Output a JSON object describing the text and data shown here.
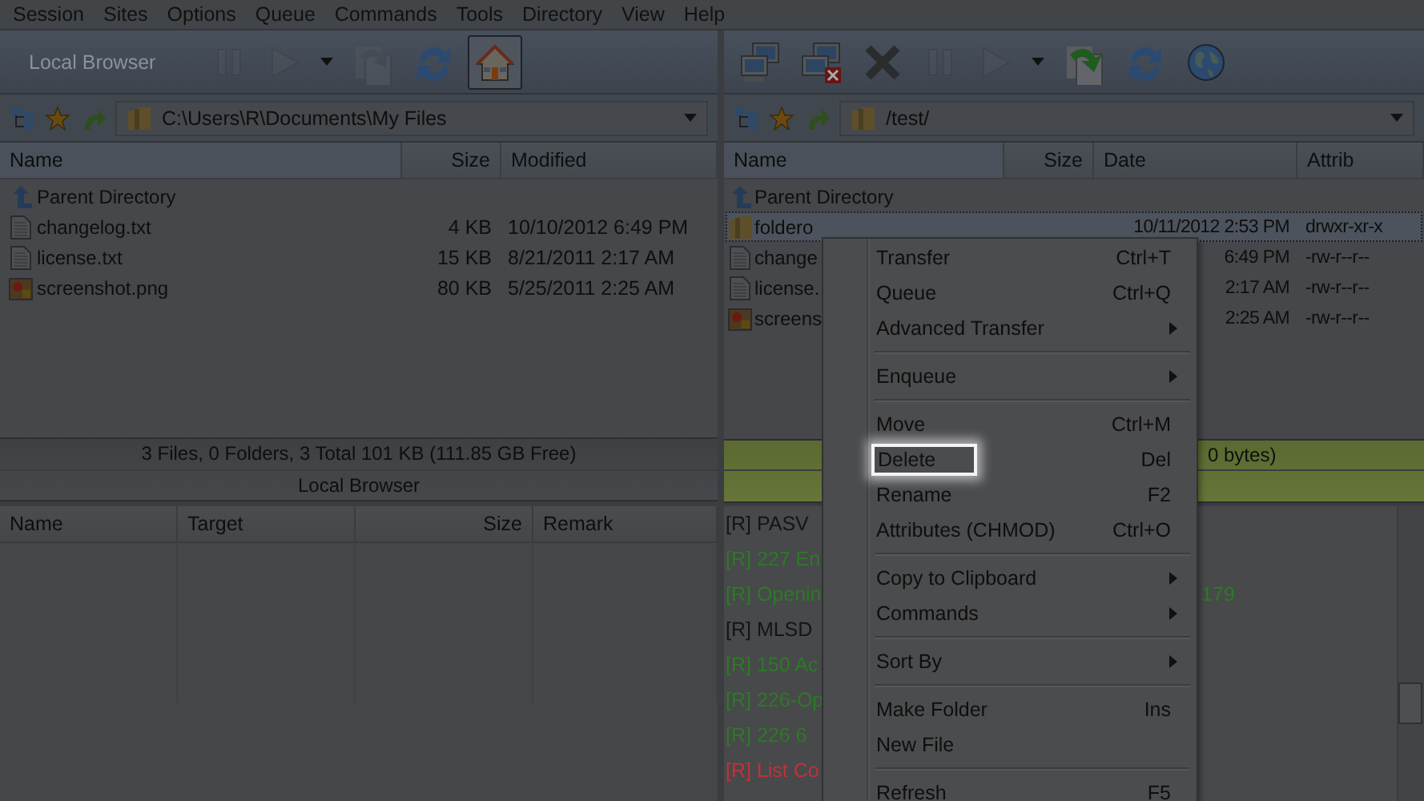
{
  "menu_bar": [
    {
      "label": "Session"
    },
    {
      "label": "Sites"
    },
    {
      "label": "Options"
    },
    {
      "label": "Queue"
    },
    {
      "label": "Commands"
    },
    {
      "label": "Tools"
    },
    {
      "label": "Directory"
    },
    {
      "label": "View"
    },
    {
      "label": "Help"
    }
  ],
  "local": {
    "toolbar_label": "Local Browser",
    "toolbar": [
      {
        "kind": "pause",
        "disabled": true,
        "pressed": false
      },
      {
        "kind": "play",
        "disabled": true,
        "pressed": false
      },
      {
        "kind": "caret",
        "disabled": false,
        "pressed": false
      },
      {
        "kind": "transfer",
        "disabled": true,
        "pressed": false
      },
      {
        "kind": "refresh",
        "disabled": false,
        "pressed": false
      },
      {
        "kind": "home",
        "disabled": false,
        "pressed": true
      }
    ],
    "path": "C:\\Users\\R\\Documents\\My Files",
    "columns": [
      "Name",
      "Size",
      "Modified"
    ],
    "rows": [
      {
        "kind": "parent",
        "name": "Parent Directory",
        "selected": false
      },
      {
        "kind": "text",
        "name": "changelog.txt",
        "size": "4 KB",
        "date": "10/10/2012 6:49 PM",
        "selected": false
      },
      {
        "kind": "text",
        "name": "license.txt",
        "size": "15 KB",
        "date": "8/21/2011 2:17 AM",
        "selected": false
      },
      {
        "kind": "image",
        "name": "screenshot.png",
        "size": "80 KB",
        "date": "5/25/2011 2:25 AM",
        "selected": false
      }
    ],
    "status": "3 Files, 0 Folders, 3 Total 101 KB (111.85 GB Free)",
    "title": "Local Browser"
  },
  "remote": {
    "toolbar": [
      {
        "kind": "connect",
        "disabled": false,
        "pressed": false
      },
      {
        "kind": "disconnect",
        "disabled": false,
        "pressed": false
      },
      {
        "kind": "cancel",
        "disabled": false,
        "pressed": false
      },
      {
        "kind": "pause",
        "disabled": true,
        "pressed": false
      },
      {
        "kind": "play",
        "disabled": true,
        "pressed": false
      },
      {
        "kind": "caret",
        "disabled": false,
        "pressed": false
      },
      {
        "kind": "download",
        "disabled": false,
        "pressed": false
      },
      {
        "kind": "refresh",
        "disabled": false,
        "pressed": false
      },
      {
        "kind": "globe",
        "disabled": false,
        "pressed": false
      }
    ],
    "path": "/test/",
    "columns": [
      "Name",
      "Size",
      "Date",
      "Attrib"
    ],
    "rows": [
      {
        "kind": "parent",
        "name": "Parent Directory",
        "selected": false
      },
      {
        "kind": "folder",
        "name": "foldero",
        "date": "10/11/2012 2:53 PM",
        "attrib": "drwxr-xr-x",
        "selected": true
      },
      {
        "kind": "text",
        "name": "change",
        "date": "6:49 PM",
        "attrib": "-rw-r--r--",
        "selected": false
      },
      {
        "kind": "text",
        "name": "license.",
        "date": "2:17 AM",
        "attrib": "-rw-r--r--",
        "selected": false
      },
      {
        "kind": "image",
        "name": "screens",
        "date": "2:25 AM",
        "attrib": "-rw-r--r--",
        "selected": false
      }
    ],
    "status": "0 bytes)"
  },
  "queue": {
    "columns": [
      "Name",
      "Target",
      "Size",
      "Remark"
    ]
  },
  "log": [
    {
      "text": "[R] PASV",
      "color": "#141414"
    },
    {
      "text": "[R] 227 En",
      "color": "#2c7a26"
    },
    {
      "text": "[R] Openin",
      "tail": "179",
      "color": "#2c7a26"
    },
    {
      "text": "[R] MLSD",
      "color": "#141414"
    },
    {
      "text": "[R] 150 Ac",
      "color": "#2c7a26"
    },
    {
      "text": "[R] 226-Op",
      "color": "#2c7a26"
    },
    {
      "text": "[R] 226 6",
      "color": "#2c7a26"
    },
    {
      "text": "[R] List Co",
      "color": "#c0323a"
    }
  ],
  "context_menu": [
    {
      "kind": "item",
      "label": "Transfer",
      "shortcut": "Ctrl+T",
      "submenu": false,
      "highlighted": false
    },
    {
      "kind": "item",
      "label": "Queue",
      "shortcut": "Ctrl+Q",
      "submenu": false,
      "highlighted": false
    },
    {
      "kind": "item",
      "label": "Advanced Transfer",
      "submenu": true,
      "highlighted": false
    },
    {
      "kind": "separator"
    },
    {
      "kind": "item",
      "label": "Enqueue",
      "submenu": true,
      "highlighted": false
    },
    {
      "kind": "separator"
    },
    {
      "kind": "item",
      "label": "Move",
      "shortcut": "Ctrl+M",
      "submenu": false,
      "highlighted": false
    },
    {
      "kind": "item",
      "label": "Delete",
      "shortcut": "Del",
      "submenu": false,
      "highlighted": true
    },
    {
      "kind": "item",
      "label": "Rename",
      "shortcut": "F2",
      "submenu": false,
      "highlighted": false
    },
    {
      "kind": "item",
      "label": "Attributes (CHMOD)",
      "shortcut": "Ctrl+O",
      "submenu": false,
      "highlighted": false
    },
    {
      "kind": "separator"
    },
    {
      "kind": "item",
      "label": "Copy to Clipboard",
      "submenu": true,
      "highlighted": false
    },
    {
      "kind": "item",
      "label": "Commands",
      "submenu": true,
      "highlighted": false
    },
    {
      "kind": "separator"
    },
    {
      "kind": "item",
      "label": "Sort By",
      "submenu": true,
      "highlighted": false
    },
    {
      "kind": "separator"
    },
    {
      "kind": "item",
      "label": "Make Folder",
      "shortcut": "Ins",
      "submenu": false,
      "highlighted": false
    },
    {
      "kind": "item",
      "label": "New File",
      "submenu": false,
      "highlighted": false
    },
    {
      "kind": "separator"
    },
    {
      "kind": "item",
      "label": "Refresh",
      "shortcut": "F5",
      "submenu": false,
      "highlighted": false
    }
  ]
}
